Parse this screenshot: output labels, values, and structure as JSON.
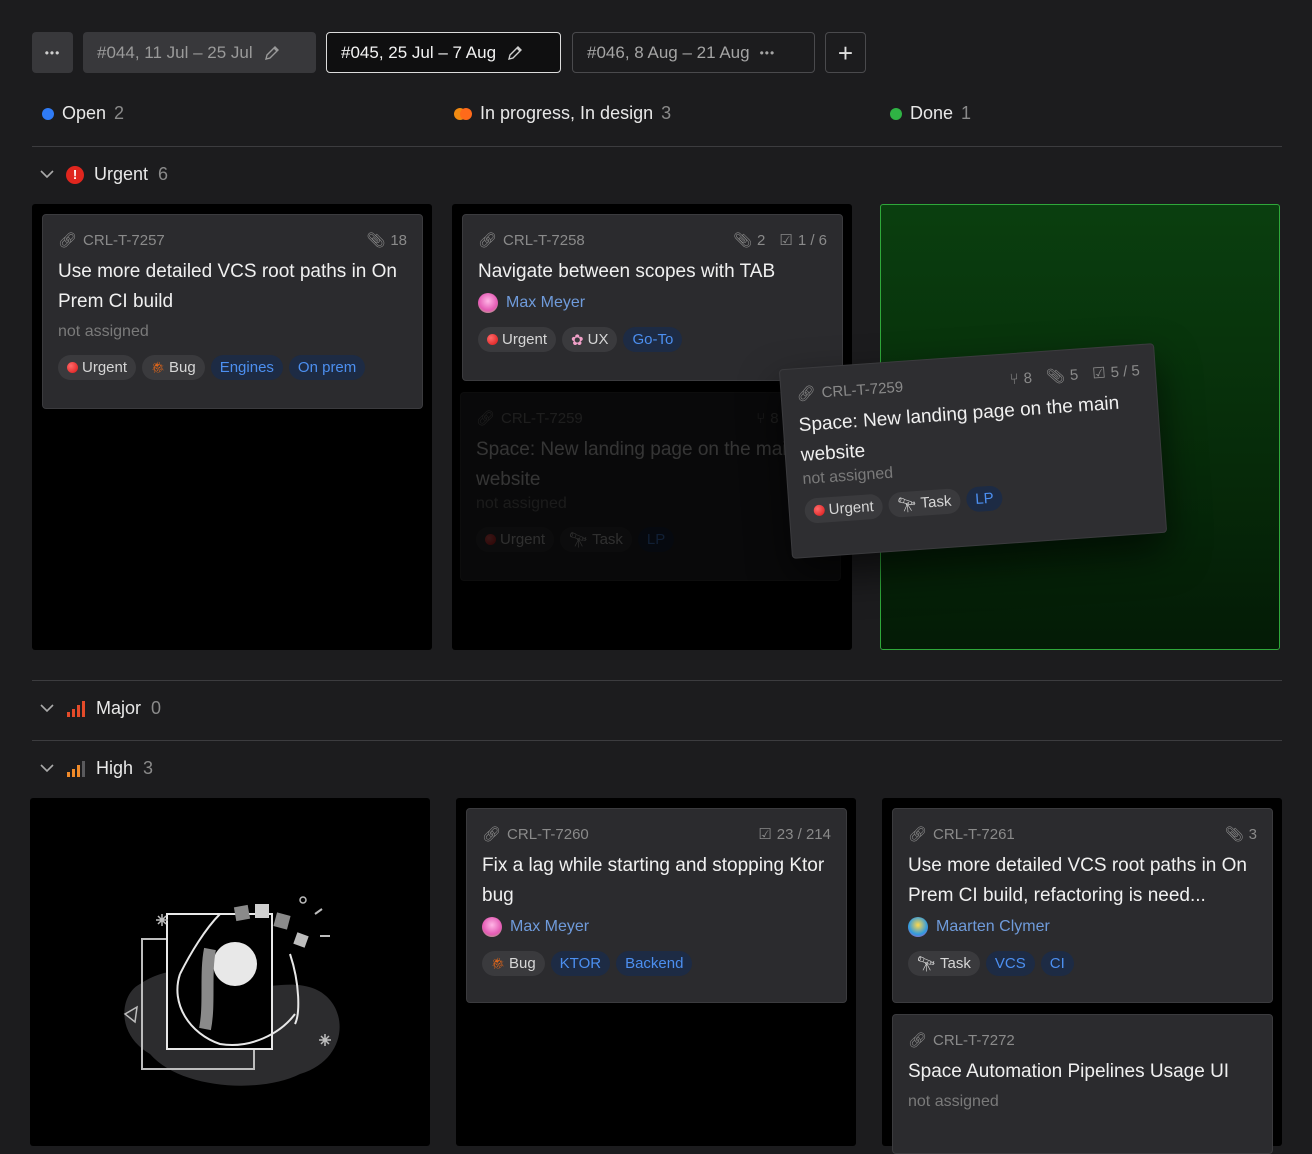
{
  "toolbar": {
    "more_label": "•••",
    "tabs": [
      {
        "label": "#044, 11 Jul – 25 Jul"
      },
      {
        "label": "#045, 25 Jul – 7 Aug"
      },
      {
        "label": "#046, 8 Aug – 21 Aug"
      }
    ],
    "add_label": "+"
  },
  "columns": [
    {
      "label": "Open",
      "count": "2",
      "color": "#2f7bf5"
    },
    {
      "label": "In progress, In design",
      "count": "3",
      "color": "#f08a12"
    },
    {
      "label": "Done",
      "count": "1",
      "color": "#2fb344"
    }
  ],
  "groups": {
    "urgent": {
      "label": "Urgent",
      "count": "6",
      "icon": "urgent-icon"
    },
    "major": {
      "label": "Major",
      "count": "0",
      "icon": "priority-bars-icon"
    },
    "high": {
      "label": "High",
      "count": "3",
      "icon": "priority-bars-icon"
    }
  },
  "cards": {
    "c7257": {
      "id": "CRL-T-7257",
      "attachments": "18",
      "title": "Use more detailed VCS root paths in On Prem CI build",
      "assignee": "not assigned",
      "tags": [
        "Urgent",
        "Bug",
        "Engines",
        "On prem"
      ]
    },
    "c7258": {
      "id": "CRL-T-7258",
      "attachments": "2",
      "checklist": "1 / 6",
      "title": "Navigate between scopes with TAB",
      "assignee": "Max Meyer",
      "tags": [
        "Urgent",
        "UX",
        "Go-To"
      ]
    },
    "c7259": {
      "id": "CRL-T-7259",
      "branches": "8",
      "attachments": "5",
      "checklist": "5 / 5",
      "title": "Space: New landing page on the main website",
      "assignee": "not assigned",
      "tags": [
        "Urgent",
        "Task",
        "LP"
      ]
    },
    "c7260": {
      "id": "CRL-T-7260",
      "checklist": "23 / 214",
      "title": "Fix a lag while starting and stopping Ktor bug",
      "assignee": "Max Meyer",
      "tags": [
        "Bug",
        "KTOR",
        "Backend"
      ]
    },
    "c7261": {
      "id": "CRL-T-7261",
      "attachments": "3",
      "title": "Use more detailed VCS root paths in On Prem CI build, refactoring is need...",
      "assignee": "Maarten Clymer",
      "tags": [
        "Task",
        "VCS",
        "CI"
      ]
    },
    "c7272": {
      "id": "CRL-T-7272",
      "title": "Space Automation Pipelines Usage UI",
      "assignee": "not assigned"
    }
  }
}
